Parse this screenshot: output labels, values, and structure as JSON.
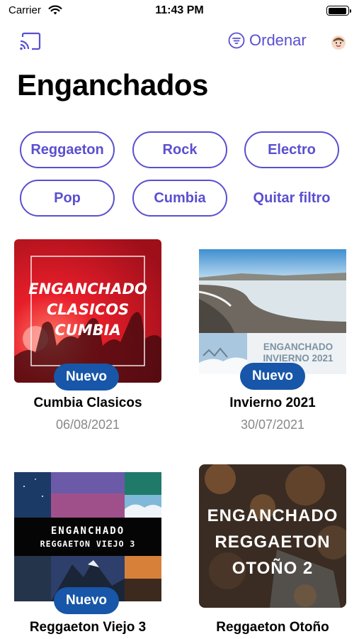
{
  "status": {
    "carrier": "Carrier",
    "time": "11:43 PM",
    "battery_level": 0.95
  },
  "nav": {
    "sort_label": "Ordenar"
  },
  "page": {
    "title": "Enganchados"
  },
  "filters": {
    "chips": [
      "Reggaeton",
      "Rock",
      "Electro",
      "Pop",
      "Cumbia"
    ],
    "clear_label": "Quitar filtro",
    "accent": "#5a4fcf"
  },
  "badge_color": "#1756a8",
  "cards": [
    {
      "title": "Cumbia Clasicos",
      "date": "06/08/2021",
      "badge": "Nuevo",
      "art": [
        "ENGANCHADO",
        "CLASICOS",
        "CUMBIA"
      ]
    },
    {
      "title": "Invierno 2021",
      "date": "30/07/2021",
      "badge": "Nuevo",
      "art": [
        "ENGANCHADO",
        "INVIERNO 2021"
      ]
    },
    {
      "title": "Reggaeton Viejo 3",
      "date": "",
      "badge": "Nuevo",
      "art": [
        "ENGANCHADO",
        "REGGAETON VIEJO 3"
      ]
    },
    {
      "title": "Reggaeton Otoño",
      "date": "",
      "badge": "",
      "art": [
        "ENGANCHADO",
        "REGGAETON",
        "OTOÑO 2"
      ]
    }
  ]
}
